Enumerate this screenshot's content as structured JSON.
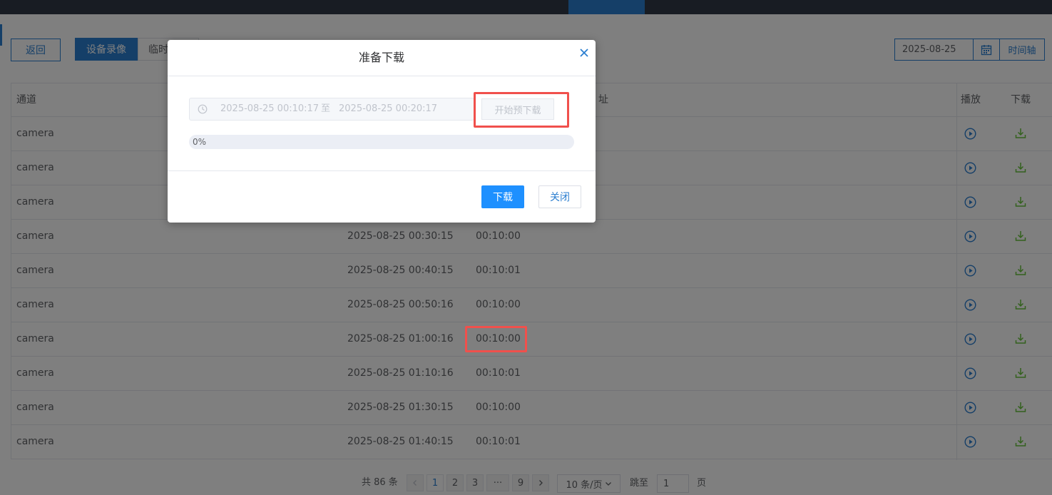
{
  "toolbar": {
    "back_label": "返回",
    "tab_device_record": "设备录像",
    "tab_temp_partial": "临时",
    "date_value": "2025-08-25",
    "timeline_label": "时间轴"
  },
  "table": {
    "headers": {
      "channel": "通道",
      "address_partial": "址",
      "play": "播放",
      "download": "下载"
    },
    "rows": [
      {
        "channel": "camera",
        "start": "",
        "duration": ""
      },
      {
        "channel": "camera",
        "start": "",
        "duration": ""
      },
      {
        "channel": "camera",
        "start": "",
        "duration": ""
      },
      {
        "channel": "camera",
        "start": "2025-08-25 00:30:15",
        "duration": "00:10:00"
      },
      {
        "channel": "camera",
        "start": "2025-08-25 00:40:15",
        "duration": "00:10:01"
      },
      {
        "channel": "camera",
        "start": "2025-08-25 00:50:16",
        "duration": "00:10:00"
      },
      {
        "channel": "camera",
        "start": "2025-08-25 01:00:16",
        "duration": "00:10:00"
      },
      {
        "channel": "camera",
        "start": "2025-08-25 01:10:16",
        "duration": "00:10:01"
      },
      {
        "channel": "camera",
        "start": "2025-08-25 01:30:15",
        "duration": "00:10:00"
      },
      {
        "channel": "camera",
        "start": "2025-08-25 01:40:15",
        "duration": "00:10:01"
      }
    ]
  },
  "pagination": {
    "total": "共 86 条",
    "pages": [
      "1",
      "2",
      "3"
    ],
    "ellipsis": "···",
    "last_page": "9",
    "page_size": "10 条/页",
    "jump_label": "跳至",
    "jump_value": "1",
    "page_suffix": "页"
  },
  "modal": {
    "title": "准备下载",
    "range_start": "2025-08-25 00:10:17",
    "range_sep": "至",
    "range_end": "2025-08-25 00:20:17",
    "pre_download_label": "开始预下载",
    "progress_percent": 0,
    "progress_text": "0%",
    "download_label": "下载",
    "close_label": "关闭"
  },
  "colors": {
    "primary": "#2b7ed0",
    "download_icon": "#67c23a",
    "highlight": "#f0504c"
  }
}
